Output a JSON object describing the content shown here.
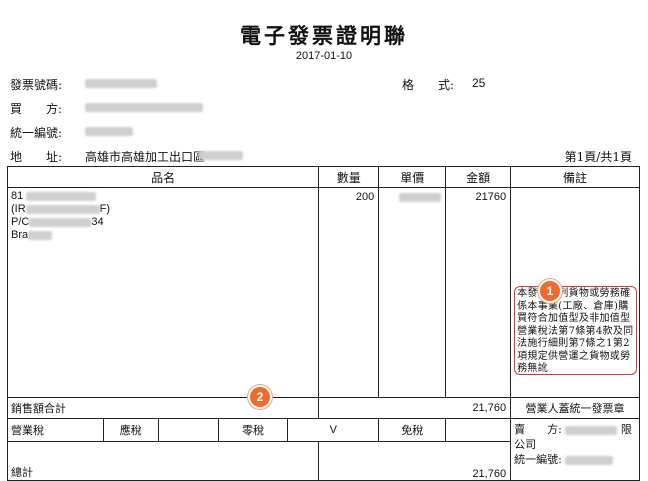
{
  "invoice": {
    "title": "電子發票證明聯",
    "date": "2017-01-10",
    "labels": {
      "number": "發票號碼:",
      "buyer": "買　　方:",
      "tax_id": "統一編號:",
      "address": "地　　址:"
    },
    "format_label": "格　　式:",
    "format_value": "25",
    "address_value": "高雄市高雄加工出口區",
    "page_info": "第1頁/共1頁"
  },
  "table": {
    "headers": [
      "品名",
      "數量",
      "單價",
      "金額",
      "備註"
    ],
    "item": {
      "line1": "81",
      "line2": "(IR",
      "line2_end": "F)",
      "line3": "P/C",
      "line3_end": "34",
      "line4": "Bra"
    },
    "quantity": "200",
    "amount": "21760",
    "remark": "本發票所列貨物或勞務確係本事業(工廠、倉庫)購買符合加值型及非加值型營業稅法第7條第4款及同法施行細則第7條之1第2項規定供營運之貨物或勞務無訛",
    "sales_total_label": "銷售額合計",
    "sales_total_value": "21,760",
    "stamp_label": "營業人蓋統一發票章",
    "tax_labels": [
      "營業稅",
      "應稅",
      "零稅",
      "免稅"
    ],
    "zero_tax_mark": "V",
    "seller_label": "賣　　方:",
    "seller_suffix": "限",
    "seller_company": "公司",
    "total_label": "總計",
    "total_value": "21,760",
    "tax_id_label": "統一編號:"
  },
  "annotations": [
    "1",
    "2"
  ]
}
